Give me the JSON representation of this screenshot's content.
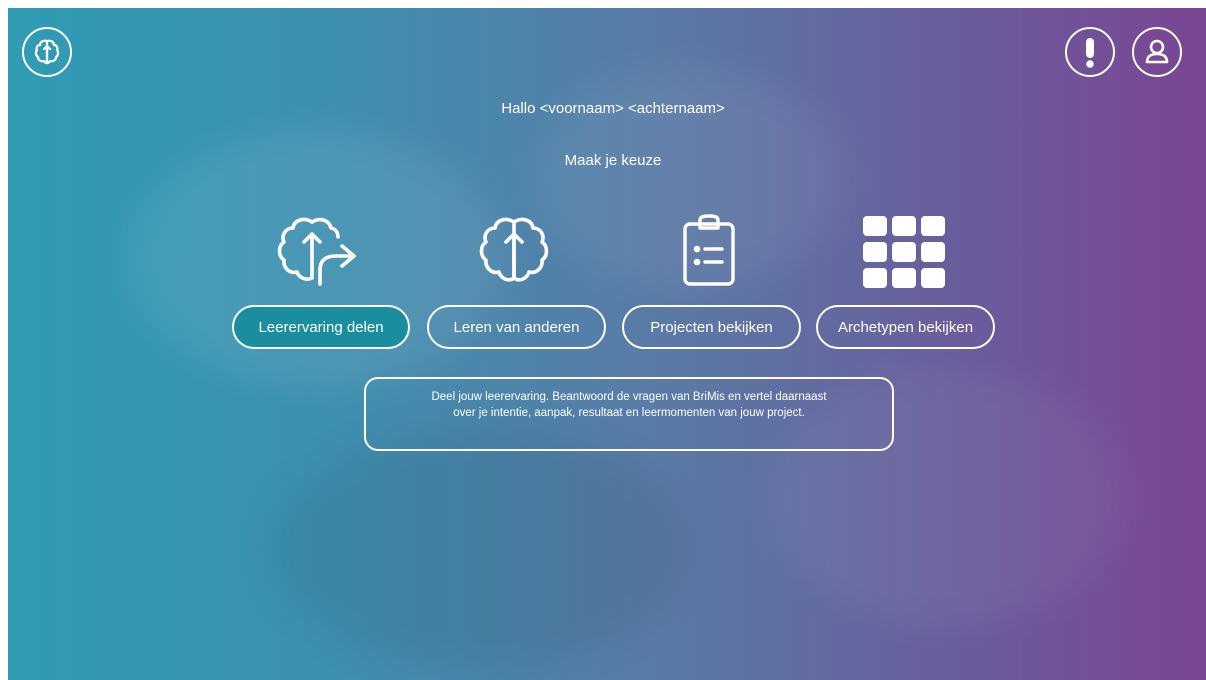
{
  "header": {
    "logo_icon": "brain-icon",
    "alert_icon": "exclamation-icon",
    "user_icon": "user-icon"
  },
  "greeting": "Hallo <voornaam> <achternaam>",
  "prompt": "Maak je keuze",
  "options": [
    {
      "label": "Leerervaring delen",
      "icon": "brain-share-icon",
      "active": true
    },
    {
      "label": "Leren van anderen",
      "icon": "brain-icon",
      "active": false
    },
    {
      "label": "Projecten bekijken",
      "icon": "clipboard-list-icon",
      "active": false
    },
    {
      "label": "Archetypen bekijken",
      "icon": "grid-icon",
      "active": false
    }
  ],
  "description": {
    "line1": "Deel jouw leerervaring. Beantwoord de vragen van BriMis en vertel daarnaast",
    "line2": "over je intentie, aanpak, resultaat en leermomenten van jouw project."
  },
  "colors": {
    "gradient_left": "#2f9cb3",
    "gradient_right": "#7a4592",
    "active_button": "#1a8e9e"
  }
}
